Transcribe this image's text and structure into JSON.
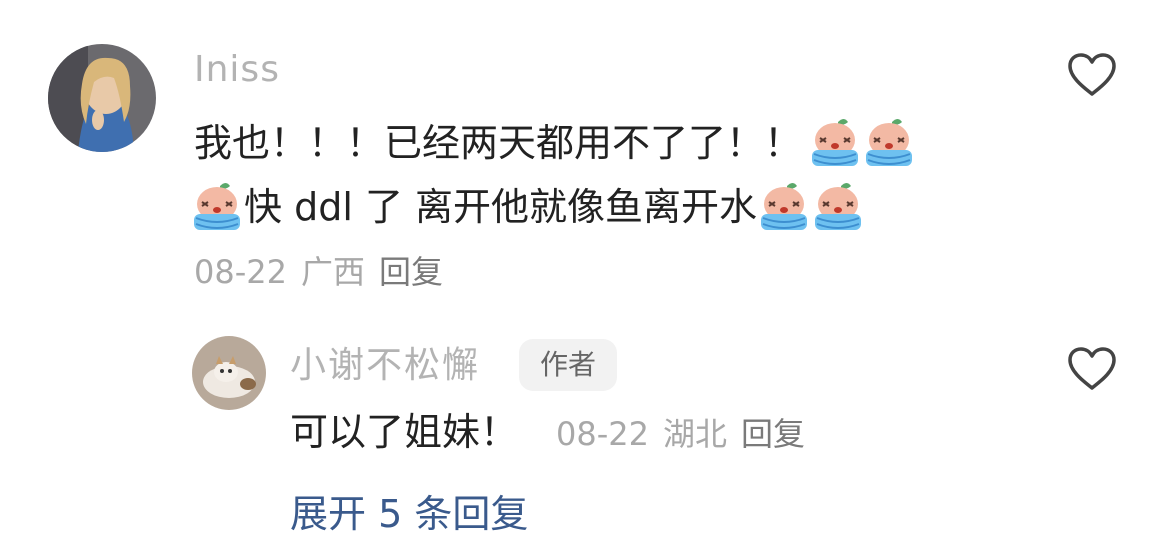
{
  "comment": {
    "username": "Iniss",
    "line1_text": "我也！！！已经两天都用不了了！！",
    "line2_text_a": "快 ddl 了 离开他就像鱼离开水",
    "date": "08-22",
    "location": "广西",
    "reply_label": "回复",
    "avatar_icon": "user-avatar-photo",
    "emoji_icon": "crying-emoji"
  },
  "reply": {
    "username": "小谢不松懈",
    "badge": "作者",
    "text": "可以了姐妹！",
    "date": "08-22",
    "location": "湖北",
    "reply_label": "回复",
    "avatar_icon": "cat-avatar-photo"
  },
  "expand": {
    "label": "展开 5 条回复"
  },
  "icons": {
    "like": "heart-outline-icon"
  },
  "colors": {
    "username": "#b3b3b3",
    "text": "#222222",
    "meta": "#a8a8a8",
    "link": "#3a5a8c",
    "badge_bg": "#f2f2f2"
  }
}
